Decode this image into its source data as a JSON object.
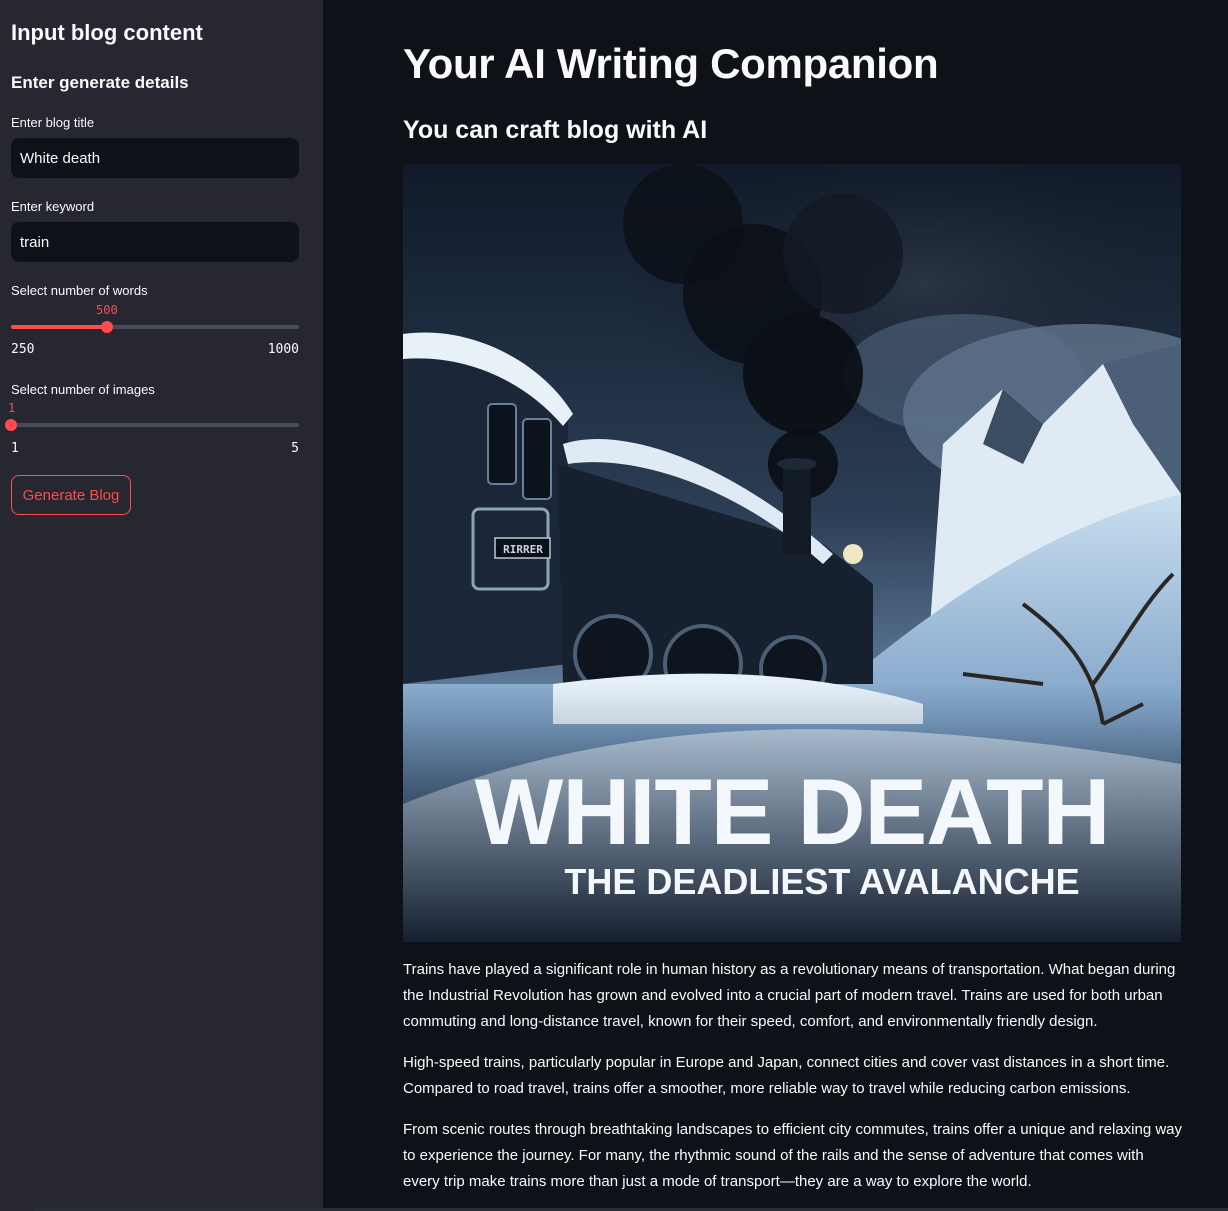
{
  "sidebar": {
    "heading": "Input blog content",
    "subheading": "Enter generate details",
    "title_field": {
      "label": "Enter blog title",
      "value": "White death"
    },
    "keyword_field": {
      "label": "Enter keyword",
      "value": "train"
    },
    "words_slider": {
      "label": "Select number of words",
      "value": "500",
      "min": "250",
      "max": "1000",
      "fraction": 0.333
    },
    "images_slider": {
      "label": "Select number of images",
      "value": "1",
      "min": "1",
      "max": "5",
      "fraction": 0.0
    },
    "generate_button": "Generate Blog"
  },
  "main": {
    "title": "Your AI Writing Companion",
    "subtitle": "You can craft blog with AI",
    "image": {
      "headline": "WHITE DEATH",
      "tagline": "THE DEADLIEST AVALANCHE",
      "plate": "RIRRER"
    },
    "paragraphs": [
      "Trains have played a significant role in human history as a revolutionary means of transportation. What began during the Industrial Revolution has grown and evolved into a crucial part of modern travel. Trains are used for both urban commuting and long-distance travel, known for their speed, comfort, and environmentally friendly design.",
      "High-speed trains, particularly popular in Europe and Japan, connect cities and cover vast distances in a short time. Compared to road travel, trains offer a smoother, more reliable way to travel while reducing carbon emissions.",
      "From scenic routes through breathtaking landscapes to efficient city commutes, trains offer a unique and relaxing way to experience the journey. For many, the rhythmic sound of the rails and the sense of adventure that comes with every trip make trains more than just a mode of transport—they are a way to explore the world."
    ]
  },
  "colors": {
    "accent": "#ff4b4b",
    "background": "#0e1117",
    "sidebar": "#262730",
    "text": "#fafafa"
  }
}
